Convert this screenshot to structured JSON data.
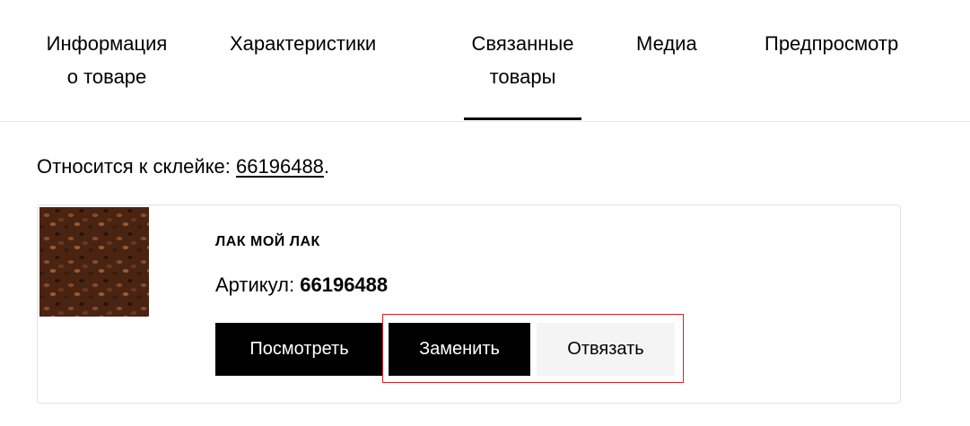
{
  "tabs": [
    {
      "line1": "Информация",
      "line2": "о товаре",
      "active": false
    },
    {
      "line1": "Характеристики",
      "line2": "",
      "active": false
    },
    {
      "line1": "Связанные",
      "line2": "товары",
      "active": true
    },
    {
      "line1": "Медиа",
      "line2": "",
      "active": false
    },
    {
      "line1": "Предпросмотр",
      "line2": "",
      "active": false
    }
  ],
  "relation": {
    "prefix": "Относится к склейке: ",
    "link": "66196488",
    "suffix": "."
  },
  "product": {
    "name": "ЛАК МОЙ ЛАК",
    "sku_label": "Артикул: ",
    "sku_value": "66196488",
    "image": "coffee-beans-image"
  },
  "actions": {
    "view": "Посмотреть",
    "replace": "Заменить",
    "unlink": "Отвязать"
  },
  "colors": {
    "primary": "#000000",
    "secondary_bg": "#f4f4f4",
    "highlight": "#e31e24"
  }
}
